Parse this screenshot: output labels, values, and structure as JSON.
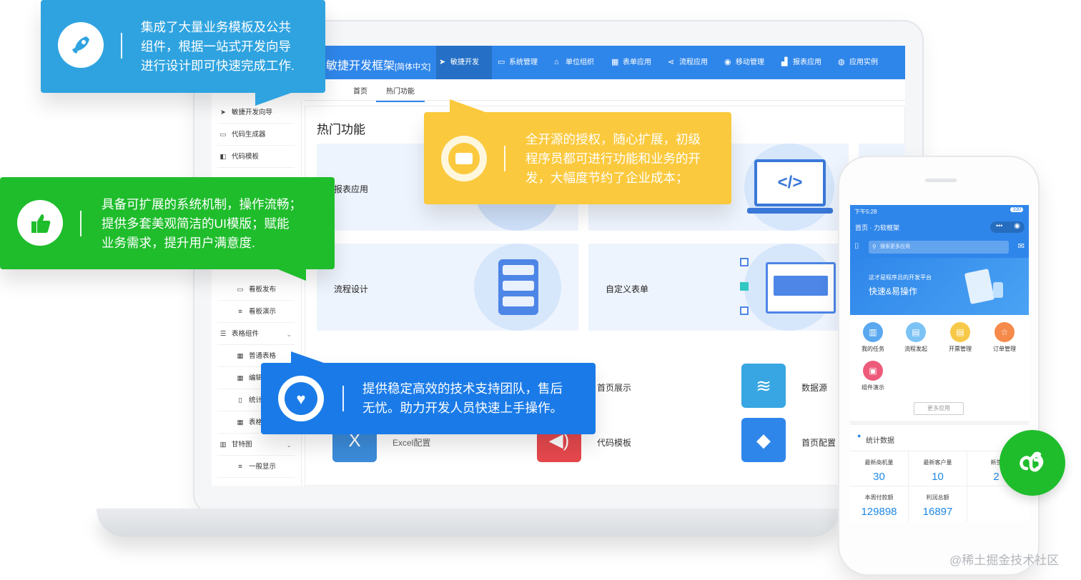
{
  "app": {
    "brand": "敏捷开发框架",
    "brand_tag": "[简体中文]"
  },
  "topnav": {
    "items": [
      {
        "label": "敏捷开发",
        "icon": "send-icon"
      },
      {
        "label": "系统管理",
        "icon": "monitor-icon"
      },
      {
        "label": "单位组织",
        "icon": "org-icon"
      },
      {
        "label": "表单应用",
        "icon": "table-icon"
      },
      {
        "label": "流程应用",
        "icon": "share-icon"
      },
      {
        "label": "移动管理",
        "icon": "android-icon"
      },
      {
        "label": "报表应用",
        "icon": "chart-icon"
      },
      {
        "label": "应用实例",
        "icon": "globe-icon"
      }
    ]
  },
  "tabs": {
    "home": "首页",
    "hot": "热门功能"
  },
  "sidebar": {
    "items": [
      {
        "label": "敏捷开发向导",
        "icon": "send-icon"
      },
      {
        "label": "代码生成器",
        "icon": "monitor-icon"
      },
      {
        "label": "代码模板",
        "icon": "template-icon"
      },
      {
        "label": "看板发布",
        "icon": "laptop-icon"
      },
      {
        "label": "看板演示",
        "icon": "list-icon"
      },
      {
        "label": "表格组件",
        "icon": "table-list-icon"
      },
      {
        "label": "普通表格",
        "icon": "grid-icon"
      },
      {
        "label": "编辑",
        "icon": "grid-icon"
      },
      {
        "label": "统计",
        "icon": "file-icon"
      },
      {
        "label": "表格",
        "icon": "grid-icon"
      },
      {
        "label": "甘特图",
        "icon": "bar-chart-icon"
      },
      {
        "label": "一般显示",
        "icon": "list-icon"
      }
    ]
  },
  "content": {
    "title": "热门功能",
    "cards": [
      {
        "label": "报表应用"
      },
      {
        "label": "流程设计"
      },
      {
        "label": "自定义表单"
      }
    ],
    "apps": [
      {
        "label": "首页展示"
      },
      {
        "label": "数据源"
      },
      {
        "label": "Excel配置"
      },
      {
        "label": "代码模板"
      },
      {
        "label": "首页配置"
      }
    ]
  },
  "callouts": {
    "blue_top": {
      "lines": [
        "集成了大量业务模板及公共",
        "组件，根据一站式开发向导",
        "进行设计即可快速完成工作."
      ],
      "color": "#2fa3e0"
    },
    "green": {
      "lines": [
        "具备可扩展的系统机制，操作流畅；",
        "提供多套美观简洁的UI模版；赋能",
        "业务需求，提升用户满意度."
      ],
      "color": "#1fbd2c"
    },
    "yellow": {
      "lines": [
        "全开源的授权，随心扩展，初级",
        "程序员都可进行功能和业务的开",
        "发，大幅度节约了企业成本；"
      ],
      "color": "#fbc93d"
    },
    "blue_bottom": {
      "lines": [
        "提供稳定高效的技术支持团队，售后",
        "无忧。助力开发人员快速上手操作。"
      ],
      "color": "#1a7be8"
    }
  },
  "phone": {
    "time": "下午5:28",
    "battery": "100",
    "header": "首页 · 力软框架",
    "search_placeholder": "搜索更多应用",
    "banner_line1": "这才是程序员的开发平台",
    "banner_line2": "快速&易操作",
    "apps": [
      {
        "label": "我的任务",
        "color": "#5aa8ef"
      },
      {
        "label": "流程发起",
        "color": "#7cc3f5"
      },
      {
        "label": "开票管理",
        "color": "#f7c948"
      },
      {
        "label": "订单管理",
        "color": "#f58a4b"
      },
      {
        "label": "组件演示",
        "color": "#ee5b7a"
      }
    ],
    "more_button": "更多应用",
    "stats_title": "统计数据",
    "stats": [
      {
        "label": "最新商机量",
        "value": "30"
      },
      {
        "label": "最新客户量",
        "value": "10"
      },
      {
        "label": "新签",
        "value": "2"
      },
      {
        "label": "本周付款额",
        "value": "129898"
      },
      {
        "label": "利润总额",
        "value": "16897"
      }
    ]
  },
  "watermark": "@稀土掘金技术社区"
}
